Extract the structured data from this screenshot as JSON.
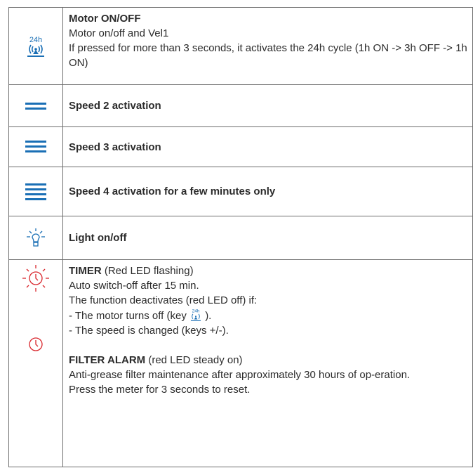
{
  "colors": {
    "accent": "#1a6fb5",
    "alert": "#d9262c",
    "border": "#6d6d6d",
    "text": "#2b2b2b"
  },
  "rows": [
    {
      "icon": "motor-24h-icon",
      "icon_text": "24h",
      "title": "Motor ON/OFF",
      "lines": [
        "Motor on/off and Vel1",
        "If pressed for more than 3 seconds, it activates the 24h cycle (1h ON -> 3h OFF -> 1h ON)"
      ]
    },
    {
      "icon": "speed-2-icon",
      "title": "Speed 2 activation"
    },
    {
      "icon": "speed-3-icon",
      "title": "Speed 3 activation"
    },
    {
      "icon": "speed-4-icon",
      "title": "Speed 4 activation for a few minutes only"
    },
    {
      "icon": "light-bulb-icon",
      "title": "Light on/off"
    },
    {
      "icons": [
        "timer-flashing-icon",
        "timer-steady-icon"
      ],
      "timer": {
        "title": "TIMER",
        "title_note": " (Red LED flashing)",
        "line1": "Auto switch-off after 15 min.",
        "line2": "The function deactivates (red LED off) if:",
        "line3_before": "- The motor turns off (key ",
        "line3_after": ").",
        "line4": "- The speed is changed (keys +/-)."
      },
      "filter": {
        "title": "FILTER ALARM",
        "title_note": " (red LED steady on)",
        "line1": "Anti-grease filter maintenance after approximately 30 hours of op-eration.",
        "line2": "Press the meter for 3 seconds to reset."
      }
    }
  ]
}
